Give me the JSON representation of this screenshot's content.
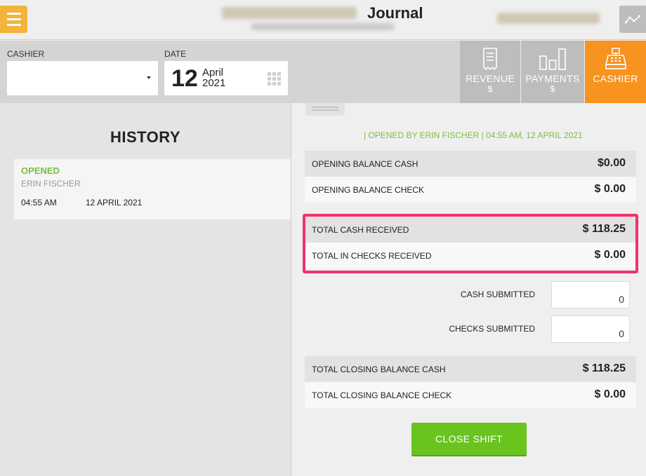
{
  "header": {
    "title": "Journal",
    "menu_icon": "hamburger-menu-icon",
    "trend_icon": "trend-line-icon"
  },
  "filters": {
    "cashier_label": "CASHIER",
    "cashier_value": "",
    "date_label": "DATE",
    "date_day": "12",
    "date_month": "April",
    "date_year": "2021"
  },
  "tabs": [
    {
      "label": "REVENUE",
      "sub": "$",
      "icon": "receipt-icon",
      "active": false
    },
    {
      "label": "PAYMENTS",
      "sub": "$",
      "icon": "bar-chart-icon",
      "active": false
    },
    {
      "label": "CASHIER",
      "sub": "",
      "icon": "cash-register-icon",
      "active": true
    }
  ],
  "history": {
    "title": "HISTORY",
    "entries": [
      {
        "status": "OPENED",
        "name": "ERIN FISCHER",
        "time": "04:55 AM",
        "date": "12 APRIL 2021"
      }
    ]
  },
  "summary": {
    "opened_by": "| OPENED BY ERIN FISCHER | 04:55 AM, 12 APRIL 2021",
    "opening_cash_label": "OPENING BALANCE CASH",
    "opening_cash_value": "$0.00",
    "opening_check_label": "OPENING BALANCE CHECK",
    "opening_check_value": "$ 0.00",
    "total_cash_label": "TOTAL CASH RECEIVED",
    "total_cash_value": "$ 118.25",
    "total_checks_label": "TOTAL IN CHECKS RECEIVED",
    "total_checks_value": "$ 0.00",
    "cash_submitted_label": "CASH SUBMITTED",
    "cash_submitted_value": "0",
    "checks_submitted_label": "CHECKS SUBMITTED",
    "checks_submitted_value": "0",
    "closing_cash_label": "TOTAL CLOSING BALANCE CASH",
    "closing_cash_value": "$ 118.25",
    "closing_check_label": "TOTAL CLOSING BALANCE CHECK",
    "closing_check_value": "$ 0.00"
  },
  "actions": {
    "close_shift": "CLOSE SHIFT"
  },
  "colors": {
    "accent_orange": "#f7931e",
    "menu_yellow": "#f3b43c",
    "status_green": "#7cbc43",
    "button_green": "#69c41d",
    "highlight_pink": "#f0336a"
  }
}
